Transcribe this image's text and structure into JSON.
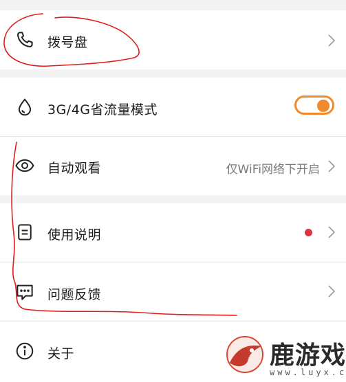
{
  "settings": {
    "items": [
      {
        "label": "拨号盘",
        "icon": "phone-icon"
      },
      {
        "label": "3G/4G省流量模式",
        "icon": "water-drop-icon",
        "toggle_on": true
      },
      {
        "label": "自动观看",
        "icon": "eye-icon",
        "value": "仅WiFi网络下开启"
      },
      {
        "label": "使用说明",
        "icon": "document-icon",
        "has_red_dot": true
      },
      {
        "label": "问题反馈",
        "icon": "chat-bubble-icon"
      },
      {
        "label": "关于",
        "icon": "info-icon"
      }
    ]
  },
  "colors": {
    "accent": "#f08a2a",
    "notification_dot": "#e0333c",
    "annotation_red": "#e21b1b"
  },
  "watermark": {
    "text": "鹿游戏",
    "url": "www.luyx.cn"
  }
}
